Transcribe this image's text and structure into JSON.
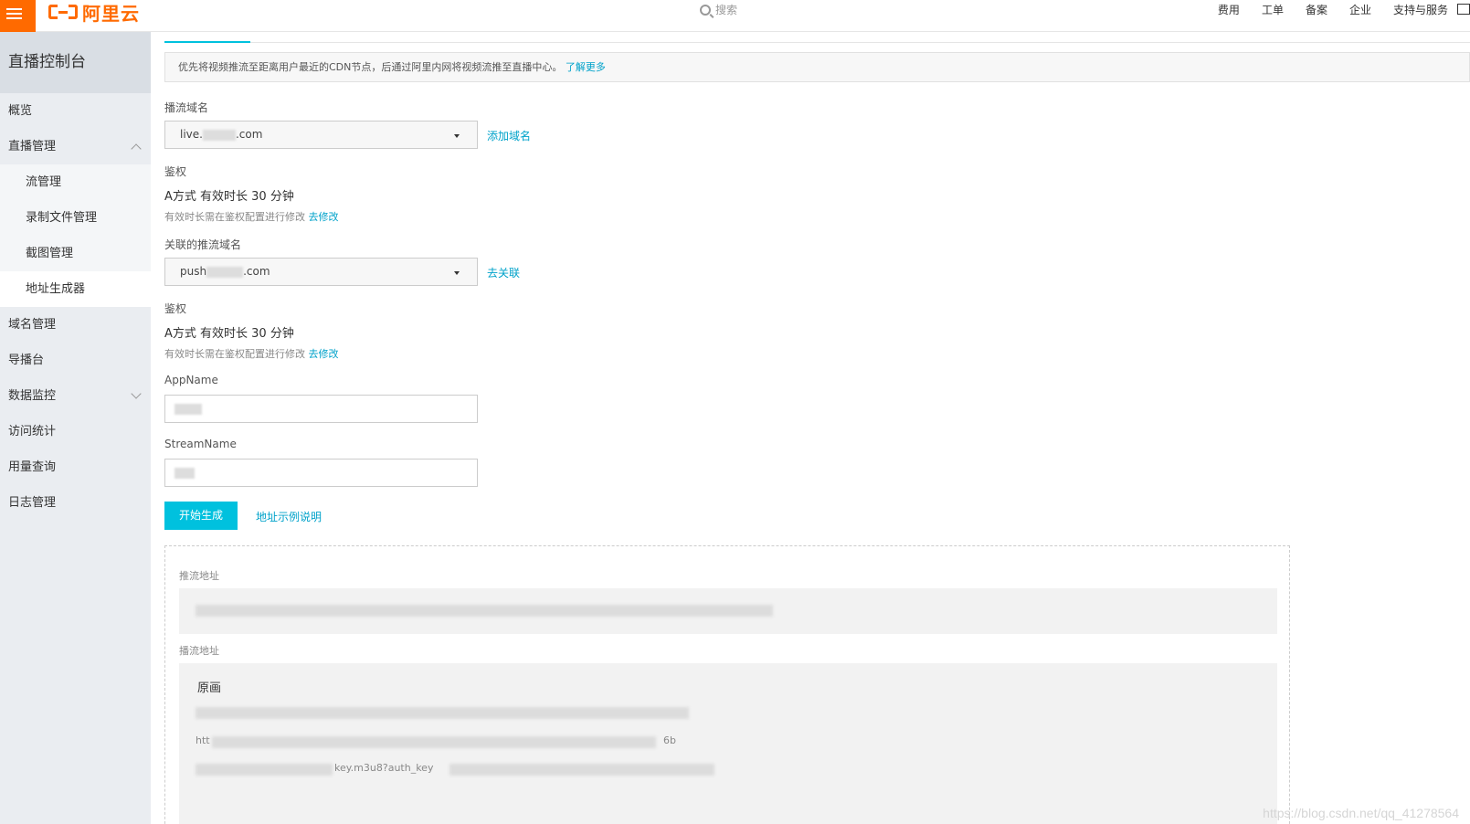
{
  "topbar": {
    "logo_text": "阿里云",
    "search_placeholder": "搜索",
    "nav": [
      "费用",
      "工单",
      "备案",
      "企业",
      "支持与服务"
    ]
  },
  "sidebar": {
    "title": "直播控制台",
    "items": [
      {
        "label": "概览"
      },
      {
        "label": "直播管理"
      },
      {
        "label": "流管理"
      },
      {
        "label": "录制文件管理"
      },
      {
        "label": "截图管理"
      },
      {
        "label": "地址生成器"
      },
      {
        "label": "域名管理"
      },
      {
        "label": "导播台"
      },
      {
        "label": "数据监控"
      },
      {
        "label": "访问统计"
      },
      {
        "label": "用量查询"
      },
      {
        "label": "日志管理"
      }
    ]
  },
  "notice": {
    "text": "优先将视频推流至距离用户最近的CDN节点，后通过阿里内网将视频流推至直播中心。",
    "link": "了解更多"
  },
  "play_domain": {
    "label": "播流域名",
    "value_prefix": "live.",
    "value_suffix": ".com",
    "link": "添加域名"
  },
  "play_auth": {
    "label": "鉴权",
    "value": "A方式 有效时长 30 分钟",
    "hint": "有效时长需在鉴权配置进行修改",
    "link": "去修改"
  },
  "push_domain": {
    "label": "关联的推流域名",
    "value_prefix": "push",
    "value_suffix": ".com",
    "link": "去关联"
  },
  "push_auth": {
    "label": "鉴权",
    "value": "A方式 有效时长 30 分钟",
    "hint": "有效时长需在鉴权配置进行修改",
    "link": "去修改"
  },
  "form": {
    "app_name_label": "AppName",
    "stream_name_label": "StreamName",
    "generate_button": "开始生成",
    "example_link": "地址示例说明"
  },
  "result": {
    "push_label": "推流地址",
    "play_label": "播流地址",
    "play_quality": "原画",
    "fragments": {
      "line2_prefix": "htt",
      "line2_tail": "6b",
      "line3_mid": "key.m3u8?auth_key"
    }
  },
  "watermark": "https://blog.csdn.net/qq_41278564",
  "colors": {
    "brand": "#ff6a00",
    "accent": "#00c1de",
    "link": "#00a2ca"
  }
}
